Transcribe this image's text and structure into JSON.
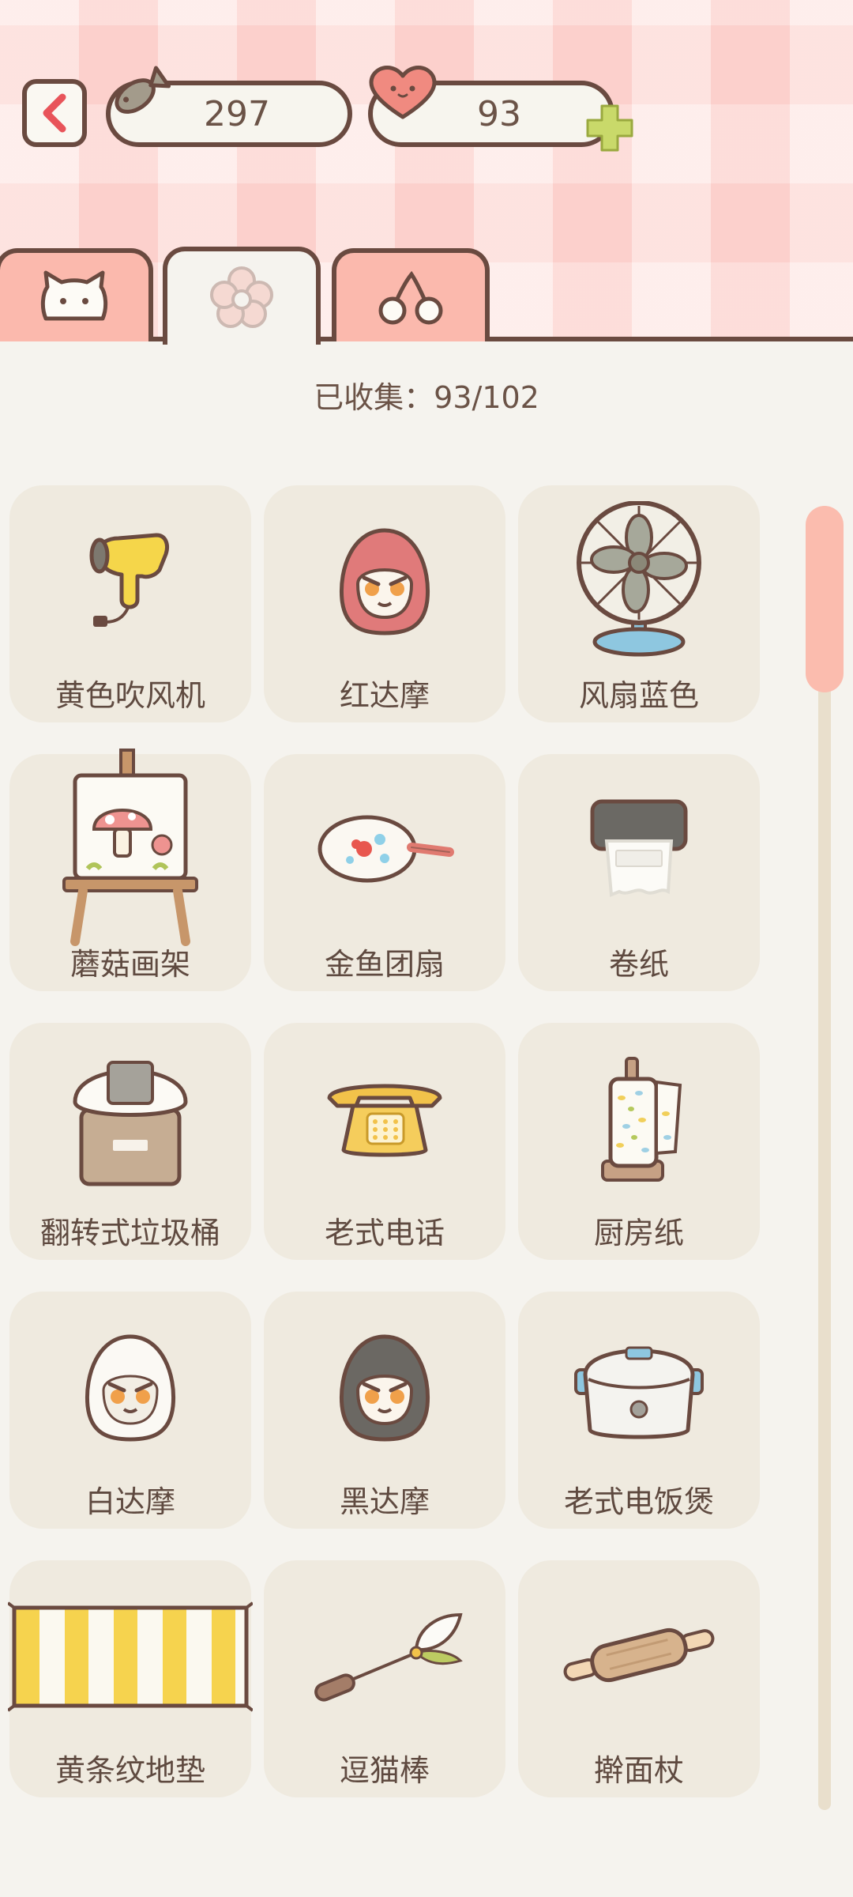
{
  "header": {
    "fish_count": "297",
    "heart_count": "93"
  },
  "tabs": [
    {
      "icon": "cat-face-icon"
    },
    {
      "icon": "flower-icon"
    },
    {
      "icon": "cherry-icon"
    }
  ],
  "collection": {
    "collected_text": "已收集：93/102"
  },
  "items": [
    {
      "label": "黄色吹风机",
      "icon": "hair-dryer-icon"
    },
    {
      "label": "红达摩",
      "icon": "red-daruma-icon"
    },
    {
      "label": "风扇蓝色",
      "icon": "blue-fan-icon"
    },
    {
      "label": "蘑菇画架",
      "icon": "mushroom-easel-icon"
    },
    {
      "label": "金鱼团扇",
      "icon": "goldfish-fan-icon"
    },
    {
      "label": "卷纸",
      "icon": "toilet-paper-icon"
    },
    {
      "label": "翻转式垃圾桶",
      "icon": "trash-bin-icon"
    },
    {
      "label": "老式电话",
      "icon": "old-phone-icon"
    },
    {
      "label": "厨房纸",
      "icon": "kitchen-paper-icon"
    },
    {
      "label": "白达摩",
      "icon": "white-daruma-icon"
    },
    {
      "label": "黑达摩",
      "icon": "black-daruma-icon"
    },
    {
      "label": "老式电饭煲",
      "icon": "rice-cooker-icon"
    },
    {
      "label": "黄条纹地垫",
      "icon": "striped-mat-icon"
    },
    {
      "label": "逗猫棒",
      "icon": "cat-teaser-icon"
    },
    {
      "label": "擀面杖",
      "icon": "rolling-pin-icon"
    }
  ],
  "colors": {
    "outline": "#6a4a40",
    "tab_pink": "#fbb9ad",
    "card_bg": "#efeadf",
    "plus_green": "#c9d96a"
  }
}
